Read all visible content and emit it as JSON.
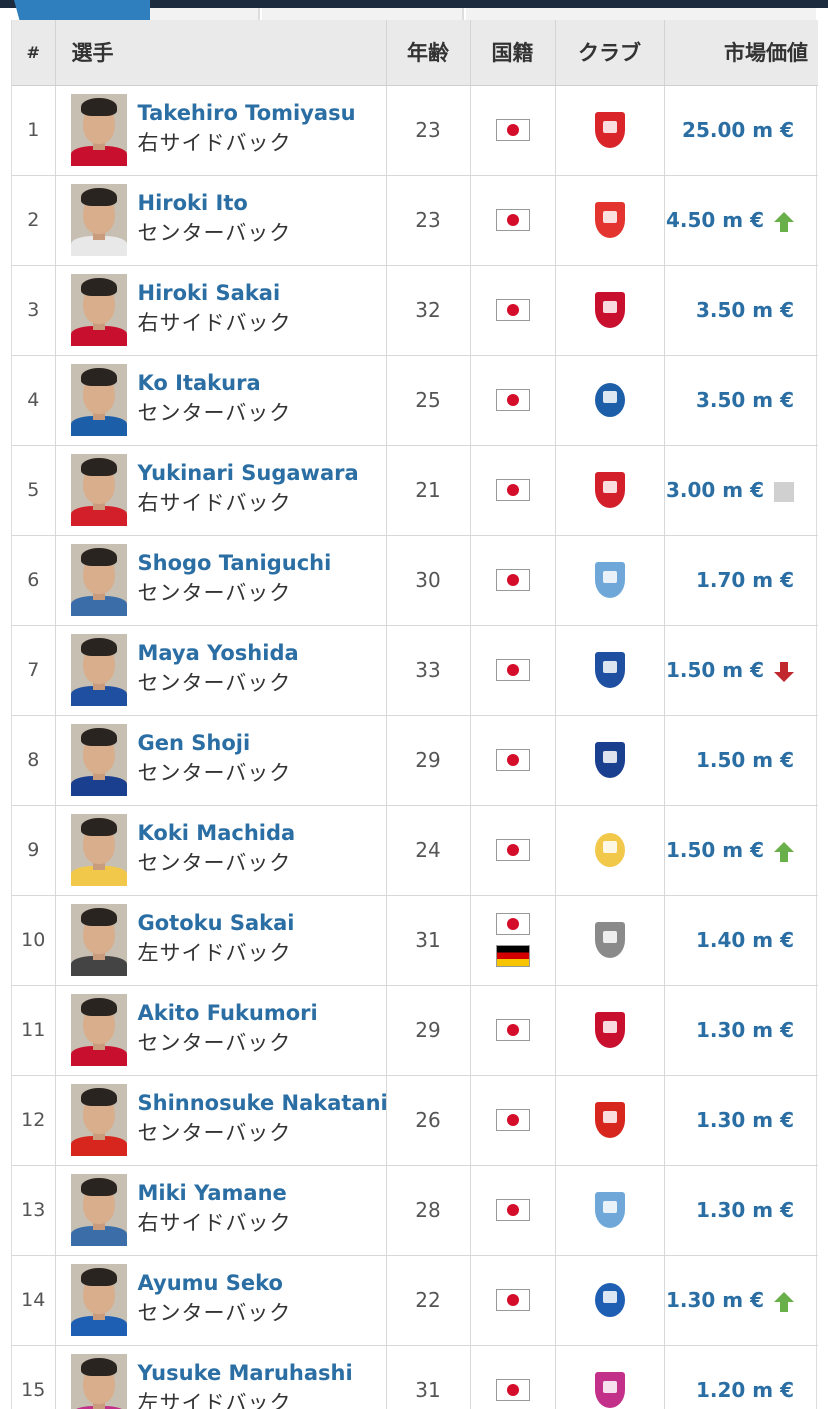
{
  "columns": {
    "num": "#",
    "player": "選手",
    "age": "年齢",
    "nationality": "国籍",
    "club": "クラブ",
    "value": "市場価値"
  },
  "colors": {
    "link": "#2a6ea3",
    "header_bg": "#eaeaea",
    "topbar": "#1d2b3e",
    "active_tab": "#2f7fbf",
    "trend_up": "#6ab04a",
    "trend_down": "#c0282e",
    "trend_same": "#d0d0d0"
  },
  "rows": [
    {
      "num": "1",
      "name": "Takehiro Tomiyasu",
      "position": "右サイドバック",
      "age": "23",
      "flags": [
        "japan-flag"
      ],
      "club_icon": "arsenal-crest",
      "club_color": "#d9252a",
      "value": "25.00 m €",
      "trend": "none"
    },
    {
      "num": "2",
      "name": "Hiroki Ito",
      "position": "センターバック",
      "age": "23",
      "flags": [
        "japan-flag"
      ],
      "club_icon": "stuttgart-crest",
      "club_color": "#e3342f",
      "value": "4.50 m €",
      "trend": "up"
    },
    {
      "num": "3",
      "name": "Hiroki Sakai",
      "position": "右サイドバック",
      "age": "32",
      "flags": [
        "japan-flag"
      ],
      "club_icon": "urawa-crest",
      "club_color": "#c8102e",
      "value": "3.50 m €",
      "trend": "none"
    },
    {
      "num": "4",
      "name": "Ko Itakura",
      "position": "センターバック",
      "age": "25",
      "flags": [
        "japan-flag"
      ],
      "club_icon": "schalke-crest",
      "club_color": "#1d5ea8",
      "value": "3.50 m €",
      "trend": "none"
    },
    {
      "num": "5",
      "name": "Yukinari Sugawara",
      "position": "右サイドバック",
      "age": "21",
      "flags": [
        "japan-flag"
      ],
      "club_icon": "az-crest",
      "club_color": "#d31f2a",
      "value": "3.00 m €",
      "trend": "same"
    },
    {
      "num": "6",
      "name": "Shogo Taniguchi",
      "position": "センターバック",
      "age": "30",
      "flags": [
        "japan-flag"
      ],
      "club_icon": "kawasaki-crest",
      "club_color": "#6fa8d8",
      "value": "1.70 m €",
      "trend": "none"
    },
    {
      "num": "7",
      "name": "Maya Yoshida",
      "position": "センターバック",
      "age": "33",
      "flags": [
        "japan-flag"
      ],
      "club_icon": "sampdoria-crest",
      "club_color": "#1f4fa0",
      "value": "1.50 m €",
      "trend": "down"
    },
    {
      "num": "8",
      "name": "Gen Shoji",
      "position": "センターバック",
      "age": "29",
      "flags": [
        "japan-flag"
      ],
      "club_icon": "gamba-crest",
      "club_color": "#1b3f8f",
      "value": "1.50 m €",
      "trend": "none"
    },
    {
      "num": "9",
      "name": "Koki Machida",
      "position": "センターバック",
      "age": "24",
      "flags": [
        "japan-flag"
      ],
      "club_icon": "union-sg-crest",
      "club_color": "#f2c84b",
      "value": "1.50 m €",
      "trend": "up"
    },
    {
      "num": "10",
      "name": "Gotoku Sakai",
      "position": "左サイドバック",
      "age": "31",
      "flags": [
        "japan-flag",
        "germany-flag"
      ],
      "club_icon": "kobe-crest",
      "club_color": "#8a8a8a",
      "value": "1.40 m €",
      "trend": "none"
    },
    {
      "num": "11",
      "name": "Akito Fukumori",
      "position": "センターバック",
      "age": "29",
      "flags": [
        "japan-flag"
      ],
      "club_icon": "sapporo-crest",
      "club_color": "#c8102e",
      "value": "1.30 m €",
      "trend": "none"
    },
    {
      "num": "12",
      "name": "Shinnosuke Nakatani",
      "position": "センターバック",
      "age": "26",
      "flags": [
        "japan-flag"
      ],
      "club_icon": "nagoya-crest",
      "club_color": "#d7261e",
      "value": "1.30 m €",
      "trend": "none"
    },
    {
      "num": "13",
      "name": "Miki Yamane",
      "position": "右サイドバック",
      "age": "28",
      "flags": [
        "japan-flag"
      ],
      "club_icon": "kawasaki-crest",
      "club_color": "#6fa8d8",
      "value": "1.30 m €",
      "trend": "none"
    },
    {
      "num": "14",
      "name": "Ayumu Seko",
      "position": "センターバック",
      "age": "22",
      "flags": [
        "japan-flag"
      ],
      "club_icon": "grasshoppers-crest",
      "club_color": "#1e5fb4",
      "value": "1.30 m €",
      "trend": "up"
    },
    {
      "num": "15",
      "name": "Yusuke Maruhashi",
      "position": "左サイドバック",
      "age": "31",
      "flags": [
        "japan-flag"
      ],
      "club_icon": "cerezo-crest",
      "club_color": "#c2308a",
      "value": "1.20 m €",
      "trend": "none"
    }
  ]
}
